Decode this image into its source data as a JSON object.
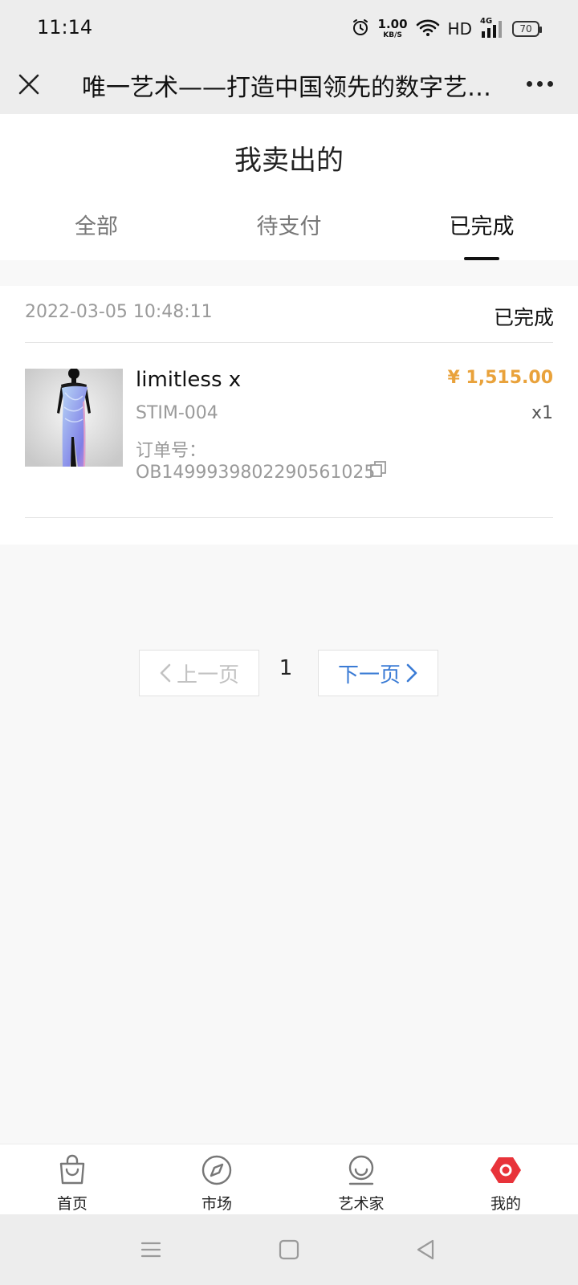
{
  "status_bar": {
    "time": "11:14",
    "net_speed_value": "1.00",
    "net_speed_unit": "KB/S",
    "hd_label": "HD",
    "signal_label": "4G",
    "battery_level": "70",
    "icons": [
      "alarm-icon",
      "wifi-icon",
      "signal-icon",
      "battery-icon"
    ]
  },
  "title_bar": {
    "title": "唯一艺术——打造中国领先的数字艺…",
    "icons": [
      "close-icon",
      "more-icon"
    ]
  },
  "page": {
    "title": "我卖出的",
    "tabs": [
      {
        "label": "全部",
        "active": false
      },
      {
        "label": "待支付",
        "active": false
      },
      {
        "label": "已完成",
        "active": true
      }
    ]
  },
  "order": {
    "date": "2022-03-05 10:48:11",
    "status": "已完成",
    "product_name": "limitless x",
    "sku": "STIM-004",
    "order_no_label": "订单号：",
    "order_no": "OB1499939802290561025",
    "price": "¥ 1,515.00",
    "quantity": "x1"
  },
  "pagination": {
    "prev_label": "上一页",
    "current_page": "1",
    "next_label": "下一页"
  },
  "tabbar": {
    "items": [
      {
        "label": "首页",
        "icon": "shopping-bag-icon"
      },
      {
        "label": "市场",
        "icon": "compass-icon"
      },
      {
        "label": "艺术家",
        "icon": "artist-icon"
      },
      {
        "label": "我的",
        "icon": "profile-icon",
        "active": true
      }
    ]
  },
  "colors": {
    "accent": "#3a7bd5",
    "price": "#e9a23b",
    "active_tab_icon": "#e8333a",
    "chrome_bg": "#ededed",
    "page_bg": "#f8f8f8"
  }
}
